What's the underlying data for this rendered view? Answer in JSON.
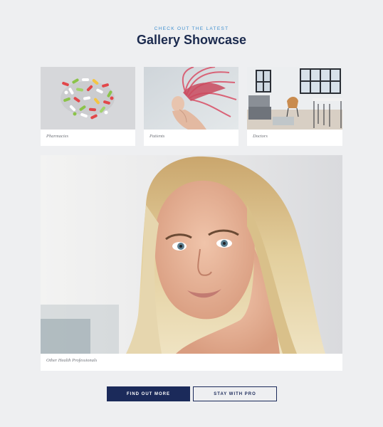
{
  "header": {
    "eyebrow": "CHECK OUT THE LATEST",
    "title": "Gallery Showcase"
  },
  "gallery": {
    "items": [
      {
        "caption": "Pharmacies"
      },
      {
        "caption": "Patients"
      },
      {
        "caption": "Doctors"
      },
      {
        "caption": "Other Health Professionals"
      }
    ]
  },
  "actions": {
    "primary_label": "FIND OUT MORE",
    "secondary_label": "STAY WITH PRO"
  },
  "colors": {
    "accent": "#3f8fcf",
    "brand": "#1b2a5a",
    "background": "#eeeff1"
  }
}
